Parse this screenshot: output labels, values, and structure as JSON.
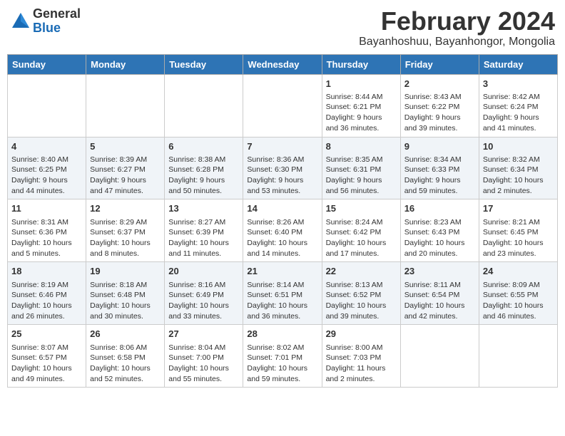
{
  "header": {
    "logo_general": "General",
    "logo_blue": "Blue",
    "title": "February 2024",
    "subtitle": "Bayanhoshuu, Bayanhongor, Mongolia"
  },
  "days_of_week": [
    "Sunday",
    "Monday",
    "Tuesday",
    "Wednesday",
    "Thursday",
    "Friday",
    "Saturday"
  ],
  "weeks": [
    [
      {
        "day": "",
        "info": ""
      },
      {
        "day": "",
        "info": ""
      },
      {
        "day": "",
        "info": ""
      },
      {
        "day": "",
        "info": ""
      },
      {
        "day": "1",
        "info": "Sunrise: 8:44 AM\nSunset: 6:21 PM\nDaylight: 9 hours and 36 minutes."
      },
      {
        "day": "2",
        "info": "Sunrise: 8:43 AM\nSunset: 6:22 PM\nDaylight: 9 hours and 39 minutes."
      },
      {
        "day": "3",
        "info": "Sunrise: 8:42 AM\nSunset: 6:24 PM\nDaylight: 9 hours and 41 minutes."
      }
    ],
    [
      {
        "day": "4",
        "info": "Sunrise: 8:40 AM\nSunset: 6:25 PM\nDaylight: 9 hours and 44 minutes."
      },
      {
        "day": "5",
        "info": "Sunrise: 8:39 AM\nSunset: 6:27 PM\nDaylight: 9 hours and 47 minutes."
      },
      {
        "day": "6",
        "info": "Sunrise: 8:38 AM\nSunset: 6:28 PM\nDaylight: 9 hours and 50 minutes."
      },
      {
        "day": "7",
        "info": "Sunrise: 8:36 AM\nSunset: 6:30 PM\nDaylight: 9 hours and 53 minutes."
      },
      {
        "day": "8",
        "info": "Sunrise: 8:35 AM\nSunset: 6:31 PM\nDaylight: 9 hours and 56 minutes."
      },
      {
        "day": "9",
        "info": "Sunrise: 8:34 AM\nSunset: 6:33 PM\nDaylight: 9 hours and 59 minutes."
      },
      {
        "day": "10",
        "info": "Sunrise: 8:32 AM\nSunset: 6:34 PM\nDaylight: 10 hours and 2 minutes."
      }
    ],
    [
      {
        "day": "11",
        "info": "Sunrise: 8:31 AM\nSunset: 6:36 PM\nDaylight: 10 hours and 5 minutes."
      },
      {
        "day": "12",
        "info": "Sunrise: 8:29 AM\nSunset: 6:37 PM\nDaylight: 10 hours and 8 minutes."
      },
      {
        "day": "13",
        "info": "Sunrise: 8:27 AM\nSunset: 6:39 PM\nDaylight: 10 hours and 11 minutes."
      },
      {
        "day": "14",
        "info": "Sunrise: 8:26 AM\nSunset: 6:40 PM\nDaylight: 10 hours and 14 minutes."
      },
      {
        "day": "15",
        "info": "Sunrise: 8:24 AM\nSunset: 6:42 PM\nDaylight: 10 hours and 17 minutes."
      },
      {
        "day": "16",
        "info": "Sunrise: 8:23 AM\nSunset: 6:43 PM\nDaylight: 10 hours and 20 minutes."
      },
      {
        "day": "17",
        "info": "Sunrise: 8:21 AM\nSunset: 6:45 PM\nDaylight: 10 hours and 23 minutes."
      }
    ],
    [
      {
        "day": "18",
        "info": "Sunrise: 8:19 AM\nSunset: 6:46 PM\nDaylight: 10 hours and 26 minutes."
      },
      {
        "day": "19",
        "info": "Sunrise: 8:18 AM\nSunset: 6:48 PM\nDaylight: 10 hours and 30 minutes."
      },
      {
        "day": "20",
        "info": "Sunrise: 8:16 AM\nSunset: 6:49 PM\nDaylight: 10 hours and 33 minutes."
      },
      {
        "day": "21",
        "info": "Sunrise: 8:14 AM\nSunset: 6:51 PM\nDaylight: 10 hours and 36 minutes."
      },
      {
        "day": "22",
        "info": "Sunrise: 8:13 AM\nSunset: 6:52 PM\nDaylight: 10 hours and 39 minutes."
      },
      {
        "day": "23",
        "info": "Sunrise: 8:11 AM\nSunset: 6:54 PM\nDaylight: 10 hours and 42 minutes."
      },
      {
        "day": "24",
        "info": "Sunrise: 8:09 AM\nSunset: 6:55 PM\nDaylight: 10 hours and 46 minutes."
      }
    ],
    [
      {
        "day": "25",
        "info": "Sunrise: 8:07 AM\nSunset: 6:57 PM\nDaylight: 10 hours and 49 minutes."
      },
      {
        "day": "26",
        "info": "Sunrise: 8:06 AM\nSunset: 6:58 PM\nDaylight: 10 hours and 52 minutes."
      },
      {
        "day": "27",
        "info": "Sunrise: 8:04 AM\nSunset: 7:00 PM\nDaylight: 10 hours and 55 minutes."
      },
      {
        "day": "28",
        "info": "Sunrise: 8:02 AM\nSunset: 7:01 PM\nDaylight: 10 hours and 59 minutes."
      },
      {
        "day": "29",
        "info": "Sunrise: 8:00 AM\nSunset: 7:03 PM\nDaylight: 11 hours and 2 minutes."
      },
      {
        "day": "",
        "info": ""
      },
      {
        "day": "",
        "info": ""
      }
    ]
  ]
}
